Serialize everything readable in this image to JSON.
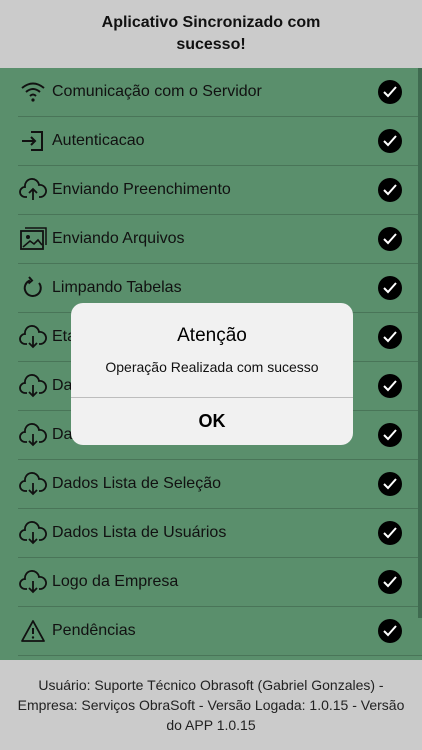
{
  "header": {
    "title": "Aplicativo Sincronizado com sucesso!"
  },
  "list": {
    "items": [
      {
        "label": "Comunicação com o Servidor",
        "icon": "wifi-icon"
      },
      {
        "label": "Autenticacao",
        "icon": "login-icon"
      },
      {
        "label": "Enviando Preenchimento",
        "icon": "cloud-upload-icon"
      },
      {
        "label": "Enviando Arquivos",
        "icon": "image-icon"
      },
      {
        "label": "Limpando Tabelas",
        "icon": "refresh-icon"
      },
      {
        "label": "Eta",
        "icon": "cloud-download-icon"
      },
      {
        "label": "Da",
        "icon": "cloud-download-icon"
      },
      {
        "label": "Da",
        "icon": "cloud-download-icon"
      },
      {
        "label": "Dados Lista de Seleção",
        "icon": "cloud-download-icon"
      },
      {
        "label": "Dados Lista de Usuários",
        "icon": "cloud-download-icon"
      },
      {
        "label": "Logo da Empresa",
        "icon": "cloud-download-icon"
      },
      {
        "label": "Pendências",
        "icon": "warning-icon"
      }
    ]
  },
  "footer": {
    "text": "Usuário: Suporte Técnico Obrasoft (Gabriel Gonzales) - Empresa: Serviços ObraSoft - Versão Logada: 1.0.15 - Versão do APP 1.0.15"
  },
  "dialog": {
    "title": "Atenção",
    "message": "Operação Realizada com sucesso",
    "ok_label": "OK"
  },
  "colors": {
    "list_bg": "#5a8f6c",
    "header_bg": "#cbcbcb",
    "check_bg": "#000000"
  }
}
